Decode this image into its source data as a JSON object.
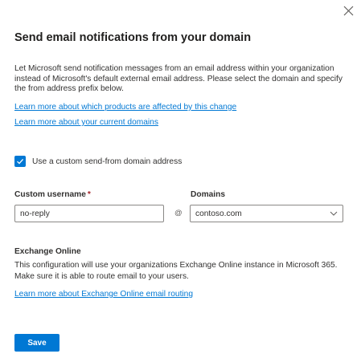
{
  "dialog": {
    "title": "Send email notifications from your domain",
    "description": "Let Microsoft send notification messages from an email address within your organization instead of Microsoft's default external email address. Please select the domain and specify the from address prefix below.",
    "links": {
      "affected_products": "Learn more about which products are affected by this change",
      "current_domains": "Learn more about your current domains",
      "exchange_routing": "Learn more about Exchange Online email routing"
    },
    "checkbox": {
      "label": "Use a custom send-from domain address",
      "checked": true
    },
    "username": {
      "label": "Custom username",
      "required_marker": "*",
      "value": "no-reply"
    },
    "at_symbol": "@",
    "domains": {
      "label": "Domains",
      "selected": "contoso.com"
    },
    "exchange": {
      "title": "Exchange Online",
      "description": "This configuration will use your organizations Exchange Online instance in Microsoft 365. Make sure it is able to route email to your users."
    },
    "save_label": "Save"
  },
  "icons": {
    "close": "close-icon",
    "checkmark": "checkmark-icon",
    "dropdown": "chevron-down-icon"
  },
  "colors": {
    "accent": "#0078d4",
    "required": "#a4262c",
    "text": "#323130"
  }
}
